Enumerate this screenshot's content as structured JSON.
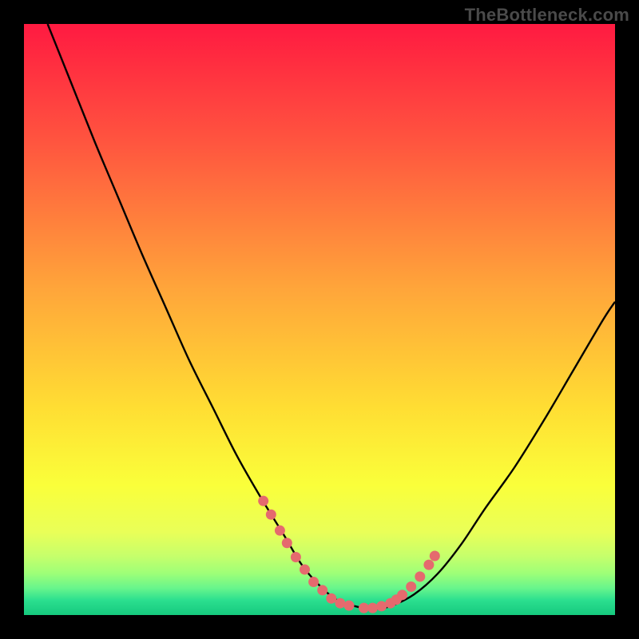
{
  "watermark": "TheBottleneck.com",
  "colors": {
    "frame": "#000000",
    "curve": "#000000",
    "points": "#E56A6E",
    "gradient_stops": [
      {
        "offset": 0.0,
        "color": "#FF1A41"
      },
      {
        "offset": 0.2,
        "color": "#FF553F"
      },
      {
        "offset": 0.45,
        "color": "#FFA63A"
      },
      {
        "offset": 0.65,
        "color": "#FFDE33"
      },
      {
        "offset": 0.78,
        "color": "#FAFF3A"
      },
      {
        "offset": 0.86,
        "color": "#E9FF58"
      },
      {
        "offset": 0.9,
        "color": "#C6FF6B"
      },
      {
        "offset": 0.93,
        "color": "#9DFF78"
      },
      {
        "offset": 0.955,
        "color": "#66F58C"
      },
      {
        "offset": 0.975,
        "color": "#2BDF8F"
      },
      {
        "offset": 1.0,
        "color": "#16C97E"
      }
    ]
  },
  "chart_data": {
    "type": "line",
    "title": "",
    "xlabel": "",
    "ylabel": "",
    "xlim": [
      0,
      100
    ],
    "ylim": [
      0,
      100
    ],
    "grid": false,
    "series": [
      {
        "name": "bottleneck-curve",
        "x": [
          4,
          8,
          12,
          16,
          20,
          24,
          28,
          32,
          36,
          40,
          44,
          47,
          50,
          53,
          56,
          59,
          62,
          66,
          70,
          74,
          78,
          83,
          88,
          93,
          98,
          100
        ],
        "y": [
          100,
          90,
          80,
          70.5,
          61,
          52,
          43,
          35,
          27,
          20,
          13.5,
          8.5,
          5,
          2.5,
          1.5,
          1,
          1.5,
          3.5,
          7,
          12,
          18,
          25,
          33,
          41.5,
          50,
          53
        ]
      }
    ],
    "points": {
      "name": "highlighted-points",
      "x": [
        40.5,
        41.8,
        43.3,
        44.5,
        46.0,
        47.5,
        49.0,
        50.5,
        52.0,
        53.5,
        55.0,
        57.5,
        59.0,
        60.5,
        62.0,
        63.0,
        64.0,
        65.5,
        67.0,
        68.5,
        69.5
      ],
      "y": [
        19.3,
        17.0,
        14.3,
        12.2,
        9.8,
        7.7,
        5.6,
        4.2,
        2.8,
        2.0,
        1.6,
        1.2,
        1.2,
        1.5,
        2.0,
        2.6,
        3.4,
        4.8,
        6.5,
        8.5,
        10.0
      ]
    }
  }
}
